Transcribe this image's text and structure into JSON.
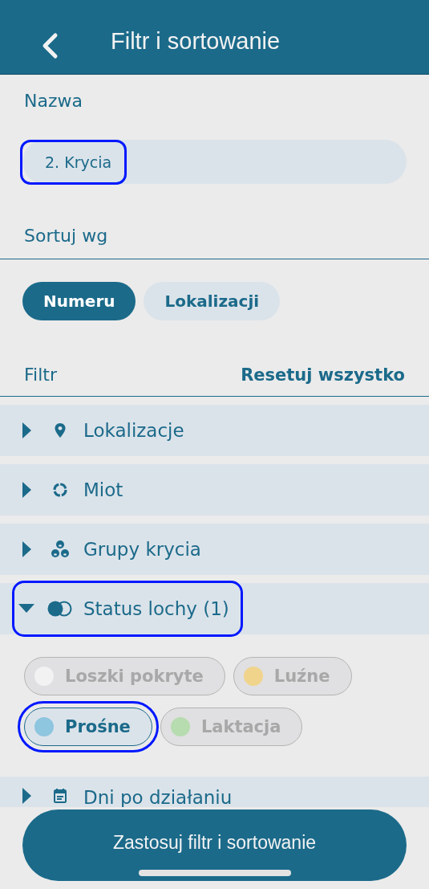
{
  "header": {
    "title": "Filtr i sortowanie"
  },
  "name_field": {
    "label": "Nazwa",
    "value": "2. Krycia",
    "highlighted": true
  },
  "sort": {
    "label": "Sortuj wg",
    "options": [
      {
        "label": "Numeru",
        "selected": true
      },
      {
        "label": "Lokalizacji",
        "selected": false
      }
    ]
  },
  "filter": {
    "label": "Filtr",
    "reset": "Resetuj wszystko",
    "sections": [
      {
        "kind": "location",
        "label": "Lokalizacje",
        "expanded": false,
        "highlighted": false
      },
      {
        "kind": "litter",
        "label": "Miot",
        "expanded": false,
        "highlighted": false
      },
      {
        "kind": "groups",
        "label": "Grupy krycia",
        "expanded": false,
        "highlighted": false
      },
      {
        "kind": "status",
        "label": "Status lochy (1)",
        "expanded": true,
        "highlighted": true,
        "options": [
          {
            "label": "Loszki pokryte",
            "color": "#f2f2f2",
            "selected": false,
            "highlighted": false
          },
          {
            "label": "Luźne",
            "color": "#f0d48c",
            "selected": false,
            "highlighted": false
          },
          {
            "label": "Prośne",
            "color": "#8ec5df",
            "selected": true,
            "highlighted": true
          },
          {
            "label": "Laktacja",
            "color": "#b6dcb0",
            "selected": false,
            "highlighted": false
          }
        ]
      },
      {
        "kind": "days",
        "label": "Dni po działaniu",
        "expanded": false,
        "highlighted": false
      }
    ]
  },
  "apply_button": "Zastosuj filtr i sortowanie"
}
